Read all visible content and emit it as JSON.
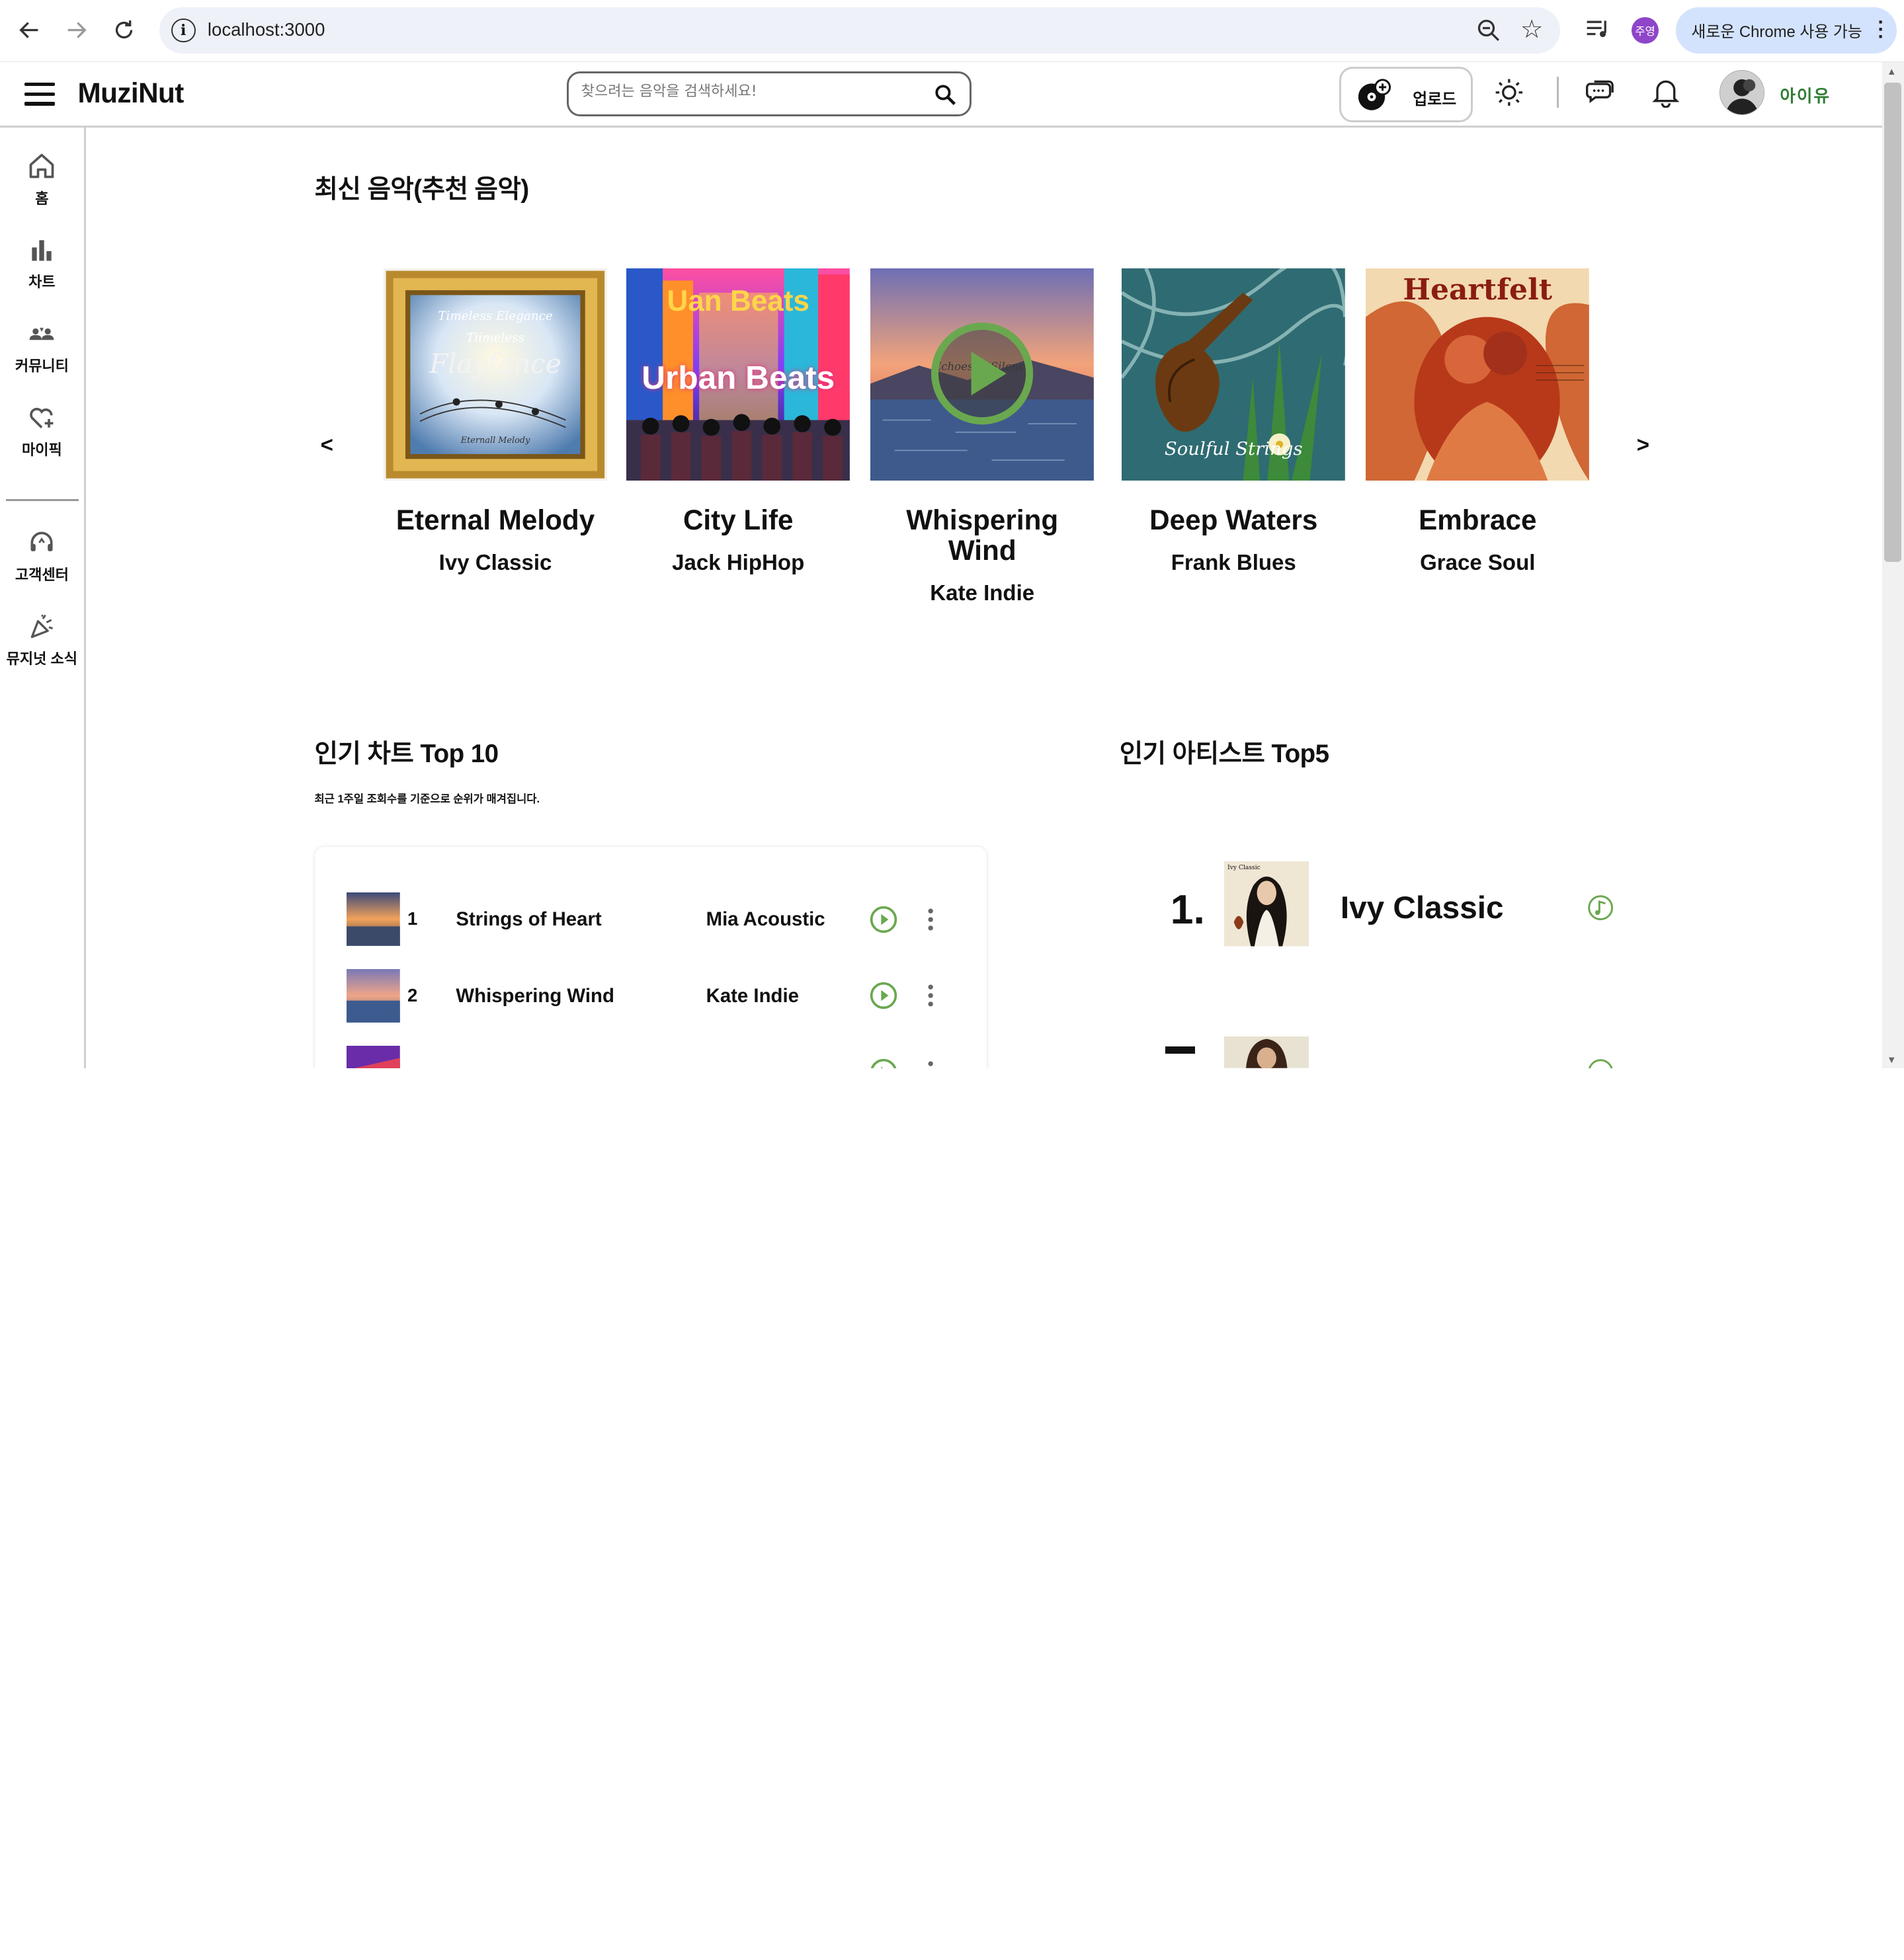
{
  "browser": {
    "url": "localhost:3000",
    "profile_initials": "주영",
    "update_label": "새로운 Chrome 사용 가능"
  },
  "header": {
    "logo": "MuziNut",
    "search_placeholder": "찾으려는 음악을 검색하세요!",
    "upload_label": "업로드",
    "username": "아이유"
  },
  "sidebar": {
    "items": [
      {
        "label": "홈",
        "icon": "home-icon"
      },
      {
        "label": "차트",
        "icon": "bar-chart-icon"
      },
      {
        "label": "커뮤니티",
        "icon": "community-icon"
      },
      {
        "label": "마이픽",
        "icon": "heart-plus-icon"
      },
      {
        "label": "고객센터",
        "icon": "headset-icon"
      },
      {
        "label": "뮤지넛 소식",
        "icon": "party-popper-icon"
      }
    ]
  },
  "latest": {
    "title": "최신 음악(추천 음악)",
    "prev": "<",
    "next": ">",
    "cards": [
      {
        "title": "Eternal Melody",
        "artist": "Ivy Classic",
        "cover_text": [
          "Timeless Elegance",
          "Tiimeless",
          "Flayfance",
          "Eternall Melody"
        ]
      },
      {
        "title": "City Life",
        "artist": "Jack HipHop",
        "cover_text": [
          "Uan Beats",
          "Urban Beats"
        ]
      },
      {
        "title": "Whispering Wind",
        "artist": "Kate Indie",
        "cover_text": [
          "Echoes of Silence"
        ]
      },
      {
        "title": "Deep Waters",
        "artist": "Frank Blues",
        "cover_text": [
          "Soulful Strings"
        ]
      },
      {
        "title": "Embrace",
        "artist": "Grace Soul",
        "cover_text": [
          "Heartfelt"
        ]
      }
    ]
  },
  "chart": {
    "title": "인기 차트 Top 10",
    "subtitle": "최근 1주일 조회수를 기준으로 순위가 매겨집니다.",
    "rows": [
      {
        "rank": "1",
        "song": "Strings of Heart",
        "artist": "Mia Acoustic"
      },
      {
        "rank": "2",
        "song": "Whispering Wind",
        "artist": "Kate Indie"
      }
    ]
  },
  "artists": {
    "title": "인기 아티스트 Top5",
    "items": [
      {
        "rank": "1.",
        "name": "Ivy Classic",
        "photo_text": "Ivy Classic"
      }
    ]
  },
  "colors": {
    "accent_green": "#6aa84f",
    "username_green": "#2e7d32"
  }
}
